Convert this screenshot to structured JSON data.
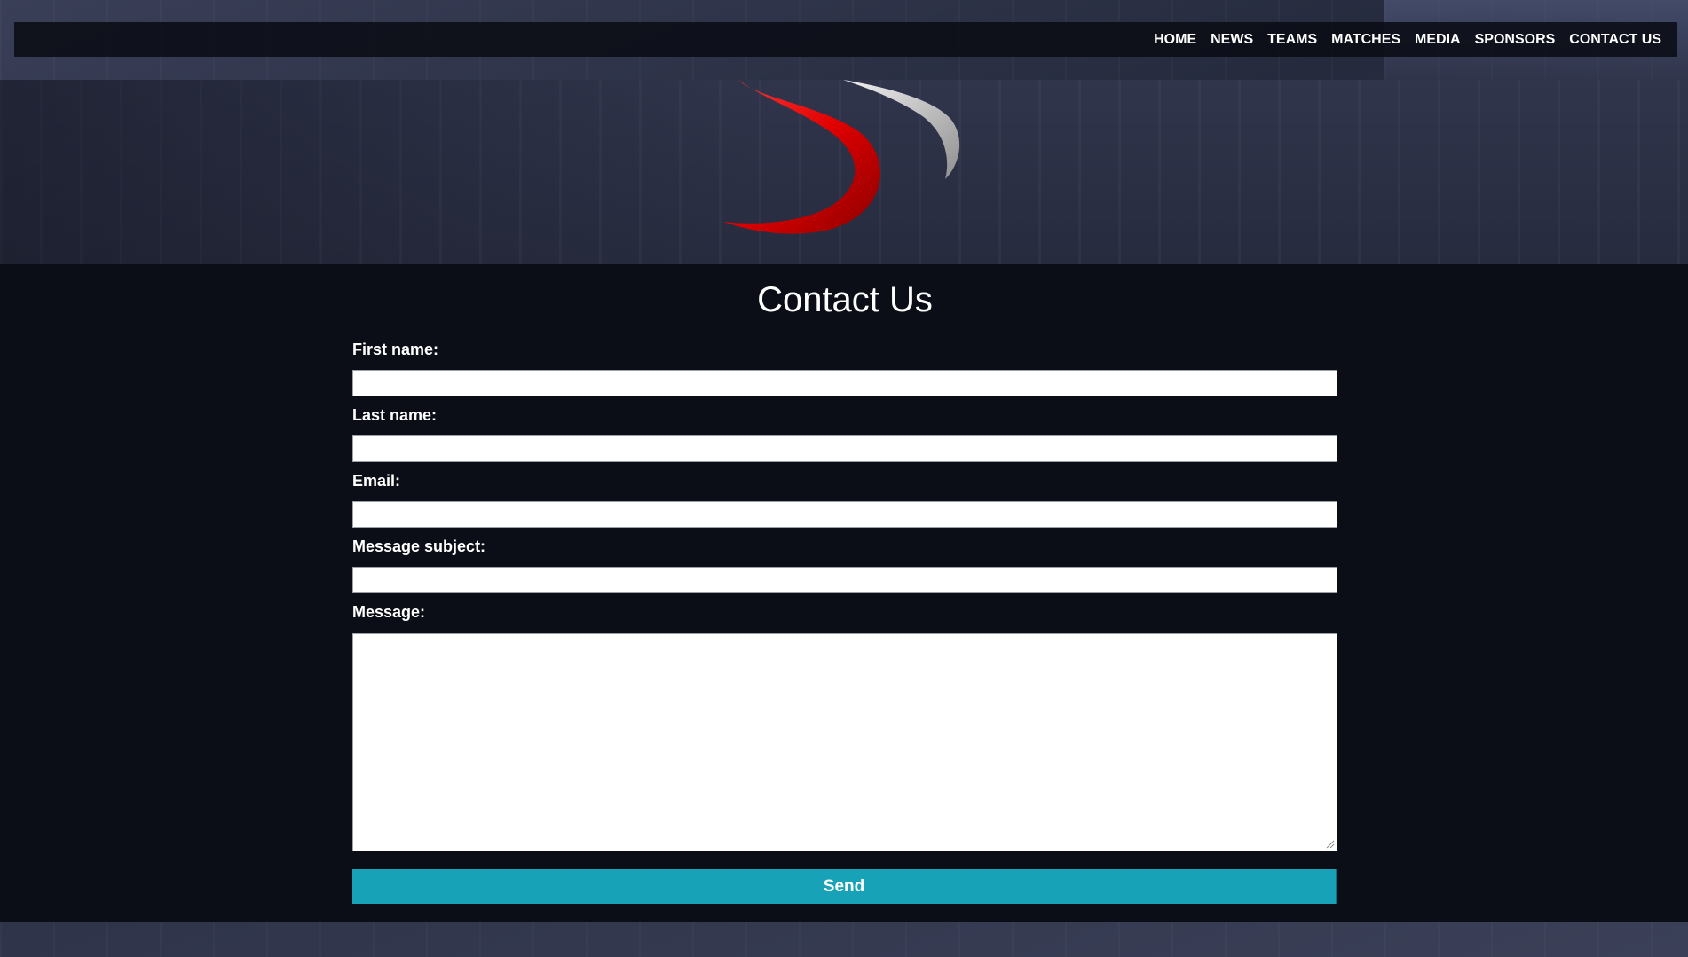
{
  "nav": {
    "items": [
      {
        "label": "HOME"
      },
      {
        "label": "NEWS"
      },
      {
        "label": "TEAMS"
      },
      {
        "label": "MATCHES"
      },
      {
        "label": "MEDIA"
      },
      {
        "label": "SPONSORS"
      },
      {
        "label": "CONTACT US"
      }
    ]
  },
  "hero": {
    "logo_icon": "swoosh-logo-icon"
  },
  "form": {
    "title": "Contact Us",
    "first_name_label": "First name:",
    "first_name_value": "",
    "last_name_label": "Last name:",
    "last_name_value": "",
    "email_label": "Email:",
    "email_value": "",
    "subject_label": "Message subject:",
    "subject_value": "",
    "message_label": "Message:",
    "message_value": "",
    "send_label": "Send"
  },
  "colors": {
    "accent": "#17a2b8",
    "logo_red": "#e00000",
    "page_background": "#0b0e16"
  }
}
